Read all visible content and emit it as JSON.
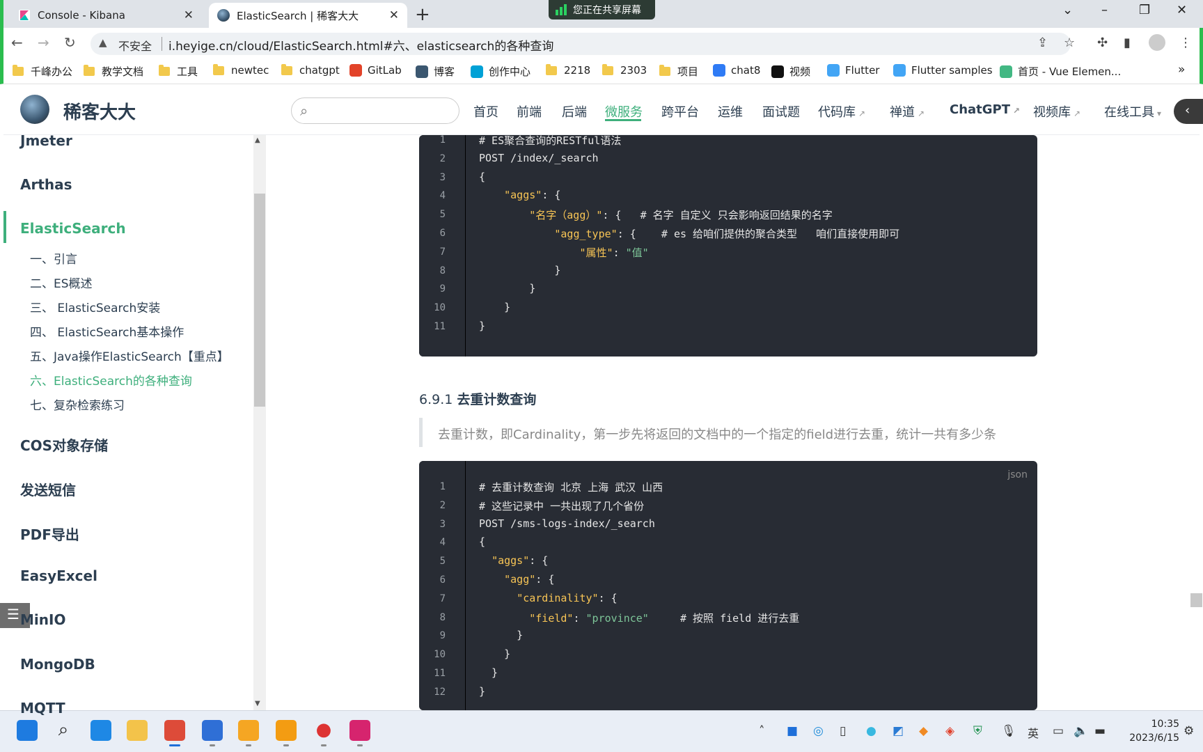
{
  "browser": {
    "tabs": [
      {
        "title": "Console - Kibana",
        "close": "✕"
      },
      {
        "title": "ElasticSearch | 稀客大大",
        "close": "✕"
      }
    ],
    "new_tab": "+",
    "sharing_banner": "您正在共享屏幕",
    "window": {
      "dropdown": "⌄",
      "minimize": "–",
      "restore": "❐",
      "close": "✕"
    },
    "address": {
      "security": "不安全",
      "url": "i.heyige.cn/cloud/ElasticSearch.html#六、elasticsearch的各种查询"
    },
    "bookmarks": [
      {
        "label": "千峰办公",
        "icon": "folder"
      },
      {
        "label": "教学文档",
        "icon": "folder"
      },
      {
        "label": "工具",
        "icon": "folder"
      },
      {
        "label": "newtec",
        "icon": "folder"
      },
      {
        "label": "chatgpt",
        "icon": "folder"
      },
      {
        "label": "GitLab",
        "icon": "gitlab-icon"
      },
      {
        "label": "博客",
        "icon": "avatar-icon"
      },
      {
        "label": "创作中心",
        "icon": "bilibili-icon"
      },
      {
        "label": "2218",
        "icon": "folder"
      },
      {
        "label": "2303",
        "icon": "folder"
      },
      {
        "label": "项目",
        "icon": "folder"
      },
      {
        "label": "chat8",
        "icon": "chat-icon"
      },
      {
        "label": "视频",
        "icon": "notion-icon"
      },
      {
        "label": "Flutter",
        "icon": "flutter-icon"
      },
      {
        "label": "Flutter samples",
        "icon": "flutter-icon"
      },
      {
        "label": "首页 - Vue Elemen...",
        "icon": "vue-icon"
      }
    ],
    "bookmarks_more": "»"
  },
  "site": {
    "title": "稀客大大",
    "nav": [
      {
        "label": "首页",
        "external": false
      },
      {
        "label": "前端",
        "external": false
      },
      {
        "label": "后端",
        "external": false
      },
      {
        "label": "微服务",
        "external": false,
        "active": true
      },
      {
        "label": "跨平台",
        "external": false
      },
      {
        "label": "运维",
        "external": false
      },
      {
        "label": "面试题",
        "external": false
      },
      {
        "label": "代码库",
        "external": true
      },
      {
        "label": "禅道",
        "external": true
      },
      {
        "label": "ChatGPT",
        "external": true
      },
      {
        "label": "视频库",
        "external": true
      },
      {
        "label": "在线工具",
        "external": false,
        "dropdown": true
      }
    ],
    "ext_mark": "↗"
  },
  "sidebar": {
    "items": [
      {
        "label": "Jmeter",
        "level": 1
      },
      {
        "label": "Arthas",
        "level": 1
      },
      {
        "label": "ElasticSearch",
        "level": 1,
        "active": true
      },
      {
        "label": "一、引言",
        "level": 2
      },
      {
        "label": "二、ES概述",
        "level": 2
      },
      {
        "label": "三、 ElasticSearch安装",
        "level": 2
      },
      {
        "label": "四、 ElasticSearch基本操作",
        "level": 2
      },
      {
        "label": "五、Java操作ElasticSearch【重点】",
        "level": 2
      },
      {
        "label": "六、ElasticSearch的各种查询",
        "level": 2,
        "active": true
      },
      {
        "label": "七、复杂检索练习",
        "level": 2
      },
      {
        "label": "COS对象存储",
        "level": 1
      },
      {
        "label": "发送短信",
        "level": 1
      },
      {
        "label": "PDF导出",
        "level": 1
      },
      {
        "label": "EasyExcel",
        "level": 1
      },
      {
        "label": "MinIO",
        "level": 1
      },
      {
        "label": "MongoDB",
        "level": 1
      },
      {
        "label": "MQTT",
        "level": 1
      }
    ]
  },
  "content": {
    "code1": {
      "lang": "json",
      "lines": [
        [
          [
            "c",
            "# ES聚合查询的RESTful语法"
          ]
        ],
        [
          [
            "c",
            "POST /index/_search"
          ]
        ],
        [
          [
            "c",
            "{"
          ]
        ],
        [
          [
            "c",
            "    "
          ],
          [
            "k",
            "\"aggs\""
          ],
          [
            "c",
            ": {"
          ]
        ],
        [
          [
            "c",
            "        "
          ],
          [
            "k",
            "\"名字（agg）\""
          ],
          [
            "c",
            ": {   # 名字 自定义 只会影响返回结果的名字"
          ]
        ],
        [
          [
            "c",
            "            "
          ],
          [
            "k",
            "\"agg_type\""
          ],
          [
            "c",
            ": {    # es 给咱们提供的聚合类型   咱们直接使用即可"
          ]
        ],
        [
          [
            "c",
            "                "
          ],
          [
            "k",
            "\"属性\""
          ],
          [
            "c",
            ": "
          ],
          [
            "s",
            "\"值\""
          ]
        ],
        [
          [
            "c",
            "            }"
          ]
        ],
        [
          [
            "c",
            "        }"
          ]
        ],
        [
          [
            "c",
            "    }"
          ]
        ],
        [
          [
            "c",
            "}"
          ]
        ]
      ]
    },
    "section_number": "6.9.1",
    "section_title": "去重计数查询",
    "blockquote": "去重计数，即Cardinality，第一步先将返回的文档中的一个指定的field进行去重，统计一共有多少条",
    "code2": {
      "lang": "json",
      "lines": [
        [
          [
            "c",
            "# 去重计数查询 北京 上海 武汉 山西"
          ]
        ],
        [
          [
            "c",
            "# 这些记录中 一共出现了几个省份"
          ]
        ],
        [
          [
            "c",
            "POST /sms-logs-index/_search"
          ]
        ],
        [
          [
            "c",
            "{"
          ]
        ],
        [
          [
            "c",
            "  "
          ],
          [
            "k",
            "\"aggs\""
          ],
          [
            "c",
            ": {"
          ]
        ],
        [
          [
            "c",
            "    "
          ],
          [
            "k",
            "\"agg\""
          ],
          [
            "c",
            ": {"
          ]
        ],
        [
          [
            "c",
            "      "
          ],
          [
            "k",
            "\"cardinality\""
          ],
          [
            "c",
            ": {"
          ]
        ],
        [
          [
            "c",
            "        "
          ],
          [
            "k",
            "\"field\""
          ],
          [
            "c",
            ": "
          ],
          [
            "s",
            "\"province\""
          ],
          [
            "c",
            "     # 按照 field 进行去重"
          ]
        ],
        [
          [
            "c",
            "      }"
          ]
        ],
        [
          [
            "c",
            "    }"
          ]
        ],
        [
          [
            "c",
            "  }"
          ]
        ],
        [
          [
            "c",
            "}"
          ]
        ]
      ]
    }
  },
  "taskbar": {
    "apps": [
      "windows-start-icon",
      "search-icon",
      "vscode-icon",
      "file-explorer-icon",
      "chrome-icon",
      "photos-icon",
      "app-icon",
      "sublime-icon",
      "record-icon",
      "intellij-icon"
    ],
    "tray": {
      "ime": "英",
      "time": "10:35",
      "date": "2023/6/15"
    }
  }
}
